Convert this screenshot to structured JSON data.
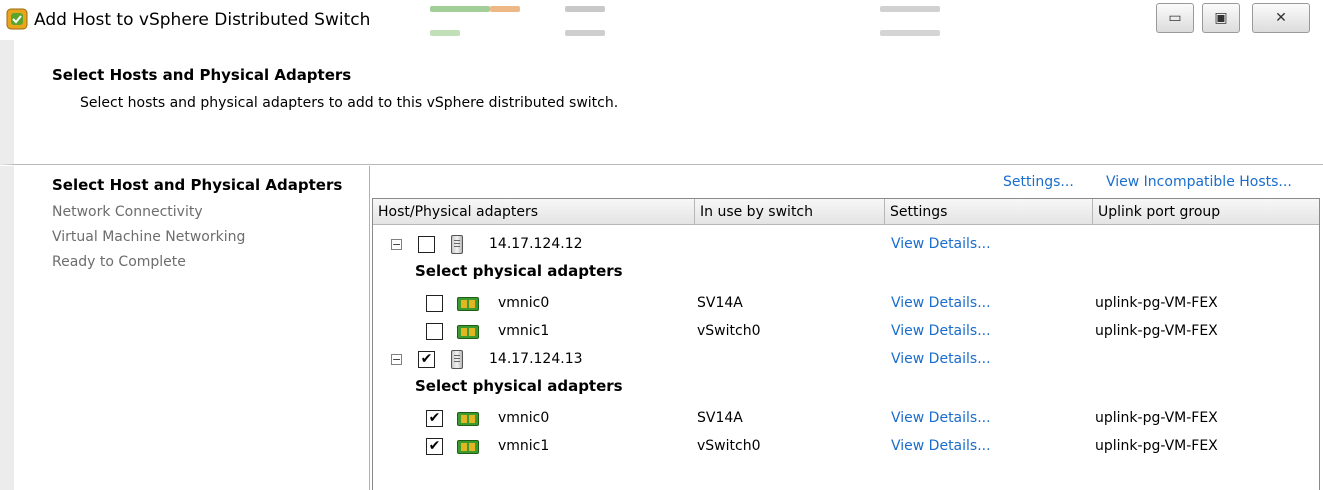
{
  "window": {
    "title": "Add Host to vSphere Distributed Switch",
    "buttons": [
      "minimize",
      "maximize",
      "close"
    ]
  },
  "header": {
    "title": "Select Hosts and Physical Adapters",
    "subtitle": "Select hosts and physical adapters to add to this vSphere distributed switch."
  },
  "nav": {
    "items": [
      {
        "label": "Select Host and Physical Adapters",
        "active": true
      },
      {
        "label": "Network Connectivity",
        "active": false
      },
      {
        "label": "Virtual Machine Networking",
        "active": false
      },
      {
        "label": "Ready to Complete",
        "active": false
      }
    ]
  },
  "links": {
    "settings": "Settings...",
    "incompatible": "View Incompatible Hosts..."
  },
  "grid": {
    "columns": [
      "Host/Physical adapters",
      "In use by switch",
      "Settings",
      "Uplink port group"
    ],
    "hosts": [
      {
        "name": "14.17.124.12",
        "checked": false,
        "settings": "View Details...",
        "section_label": "Select physical adapters",
        "adapters": [
          {
            "name": "vmnic0",
            "switch": "SV14A",
            "settings": "View Details...",
            "uplink": "uplink-pg-VM-FEX",
            "checked": false
          },
          {
            "name": "vmnic1",
            "switch": "vSwitch0",
            "settings": "View Details...",
            "uplink": "uplink-pg-VM-FEX",
            "checked": false
          }
        ]
      },
      {
        "name": "14.17.124.13",
        "checked": true,
        "settings": "View Details...",
        "section_label": "Select physical adapters",
        "adapters": [
          {
            "name": "vmnic0",
            "switch": "SV14A",
            "settings": "View Details...",
            "uplink": "uplink-pg-VM-FEX",
            "checked": true
          },
          {
            "name": "vmnic1",
            "switch": "vSwitch0",
            "settings": "View Details...",
            "uplink": "uplink-pg-VM-FEX",
            "checked": true
          }
        ]
      }
    ]
  },
  "colors": {
    "link": "#1a6dcc",
    "nav_inactive": "#6d6d6d",
    "nic_green": "#3d9a2e"
  },
  "glyphs": {
    "check": "✔",
    "collapse": "−",
    "minimize": "▭",
    "maximize": "▣",
    "close": "✕"
  }
}
